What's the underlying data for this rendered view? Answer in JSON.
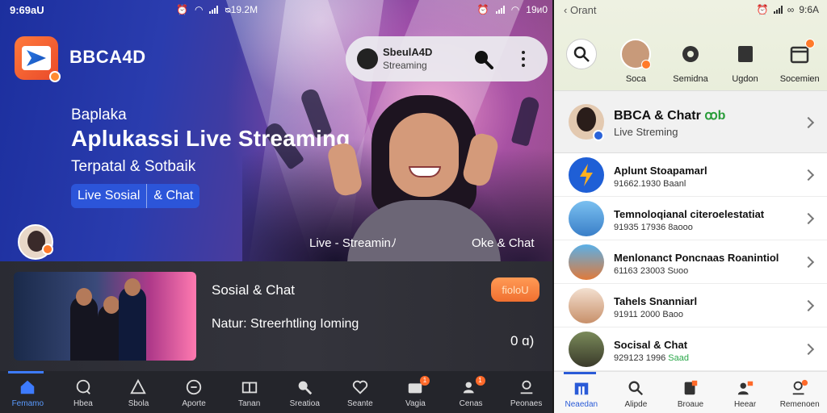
{
  "left": {
    "status": {
      "time": "9:69aU",
      "center": "ᴓ19.2M",
      "right": "19ᴎ0"
    },
    "app": {
      "name": "BBCA4D"
    },
    "search_pill": {
      "title": "SbeulA4D",
      "subtitle": "Streaming"
    },
    "hero": {
      "pretitle": "Baplaka",
      "title": "Aplukassi Live Streaming",
      "subtitle": "Terpatal & Sotbaik",
      "chips": [
        "Live Sosial",
        "& Chat"
      ],
      "live_label": "Live - Streaminﾉ",
      "chat_label": "Oke & Chat"
    },
    "card": {
      "title": "Sosial & Chat",
      "subtitle": "Natur: Streerhtling Ioming",
      "cta": "fioloU",
      "count": "0 ɑ)"
    },
    "bottom_nav": [
      {
        "label": "Femamo",
        "icon": "home-icon",
        "active": true
      },
      {
        "label": "Hbea",
        "icon": "chat-icon"
      },
      {
        "label": "Sbola",
        "icon": "triangle-icon"
      },
      {
        "label": "Aporte",
        "icon": "message-icon"
      },
      {
        "label": "Tanan",
        "icon": "tv-icon"
      },
      {
        "label": "Sreatioa",
        "icon": "search-person-icon"
      },
      {
        "label": "Seante",
        "icon": "heart-icon"
      },
      {
        "label": "Vagia",
        "icon": "folder-icon",
        "badge": "1"
      },
      {
        "label": "Cenas",
        "icon": "users-icon",
        "badge": "1"
      },
      {
        "label": "Peonaes",
        "icon": "profile-icon"
      }
    ]
  },
  "right": {
    "status": {
      "back": "Orant",
      "time": "9:6A"
    },
    "top_icons": [
      {
        "label": "",
        "icon": "search-icon"
      },
      {
        "label": "Soca",
        "icon": "avatar-icon"
      },
      {
        "label": "Semidna",
        "icon": "gear-icon"
      },
      {
        "label": "Ugdon",
        "icon": "book-icon"
      },
      {
        "label": "Socemien",
        "icon": "calendar-icon"
      }
    ],
    "feature": {
      "title": "BBCA & Chatr",
      "title_suffix": "ꝏb",
      "subtitle": "Live Streming"
    },
    "rows": [
      {
        "title": "Aplunt Stoapamarl",
        "sub": "91662.1930 Baanl",
        "avatar": "bolt"
      },
      {
        "title": "Temnoloqianal citeroelestatiat",
        "sub": "91935 17936 8aooo",
        "avatar": "group1"
      },
      {
        "title": "Menlonanct Poncnaas Roanintiol",
        "sub": "61163 23003 Sʊoo",
        "avatar": "group2"
      },
      {
        "title": "Tahels Snanniarl",
        "sub": "91911 2000 Baoo",
        "avatar": "pair"
      },
      {
        "title": "Socisal & Chat",
        "sub": "929123 1996",
        "sub_green": "Saad",
        "avatar": "group3"
      }
    ],
    "bottom_nav": [
      {
        "label": "Neaedan",
        "icon": "building-icon",
        "active": true
      },
      {
        "label": "Alipde",
        "icon": "search-icon"
      },
      {
        "label": "Broaue",
        "icon": "book-badge-icon"
      },
      {
        "label": "Heear",
        "icon": "person-flag-icon"
      },
      {
        "label": "Remenoen",
        "icon": "profile-badge-icon"
      }
    ]
  }
}
